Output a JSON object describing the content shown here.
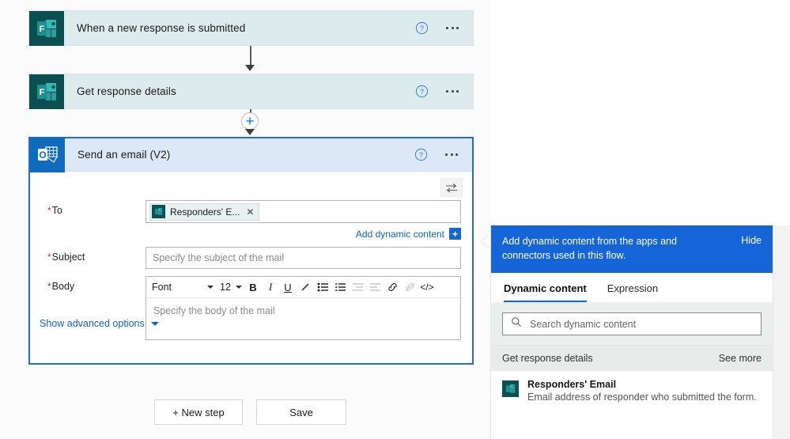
{
  "flow": {
    "steps": [
      {
        "title": "When a new response is submitted",
        "icon": "microsoft-forms-icon",
        "help_icon": "help-circle-icon",
        "more_icon": "ellipsis-icon"
      },
      {
        "title": "Get response details",
        "icon": "microsoft-forms-icon",
        "help_icon": "help-circle-icon",
        "more_icon": "ellipsis-icon"
      }
    ],
    "insert_step_icon": "plus-circle-icon"
  },
  "send_email": {
    "title": "Send an email (V2)",
    "icon": "outlook-icon",
    "help_icon": "help-circle-icon",
    "more_icon": "ellipsis-icon",
    "swap_icon": "switch-input-arrows-icon",
    "to": {
      "label": "To",
      "required_marker": "*",
      "token_label": "Responders' E...",
      "token_icon": "microsoft-forms-icon",
      "token_remove_icon": "close-icon"
    },
    "add_dynamic_content": {
      "label": "Add dynamic content",
      "plus_label": "+"
    },
    "subject": {
      "label": "Subject",
      "required_marker": "*",
      "placeholder": "Specify the subject of the mail",
      "value": ""
    },
    "body": {
      "label": "Body",
      "required_marker": "*",
      "placeholder": "Specify the body of the mail",
      "value": ""
    },
    "toolbar": {
      "font_name": "Font",
      "font_size": "12",
      "bold": "B",
      "italic": "I",
      "underline": "U",
      "highlight_icon": "pen-highlight-icon",
      "bulleted_list_icon": "bulleted-list-icon",
      "numbered_list_icon": "numbered-list-icon",
      "indent_icon": "indent-icon",
      "outdent_icon": "outdent-icon",
      "link_icon": "link-icon",
      "unlink_icon": "unlink-icon",
      "code_view_label": "</>"
    },
    "show_advanced_options": "Show advanced options",
    "chevron_icon": "chevron-down-icon"
  },
  "footer": {
    "new_step": "+ New step",
    "save": "Save"
  },
  "dynamic_content": {
    "header_text": "Add dynamic content from the apps and connectors used in this flow.",
    "hide_label": "Hide",
    "tabs": [
      {
        "label": "Dynamic content",
        "active": true
      },
      {
        "label": "Expression",
        "active": false
      }
    ],
    "search": {
      "placeholder": "Search dynamic content",
      "icon": "search-icon",
      "value": ""
    },
    "group": {
      "name": "Get response details",
      "see_more": "See more"
    },
    "items": [
      {
        "title": "Responders' Email",
        "description": "Email address of responder who submitted the form.",
        "icon": "microsoft-forms-icon"
      }
    ]
  },
  "colors": {
    "accent_blue": "#1565d8",
    "link_blue": "#0f62c9",
    "forms_teal": "#0b4f52",
    "outlook_blue": "#0f6cbd",
    "card_bg": "#ddebec",
    "selected_header_bg": "#dce8f5",
    "required_red": "#c4314b"
  }
}
